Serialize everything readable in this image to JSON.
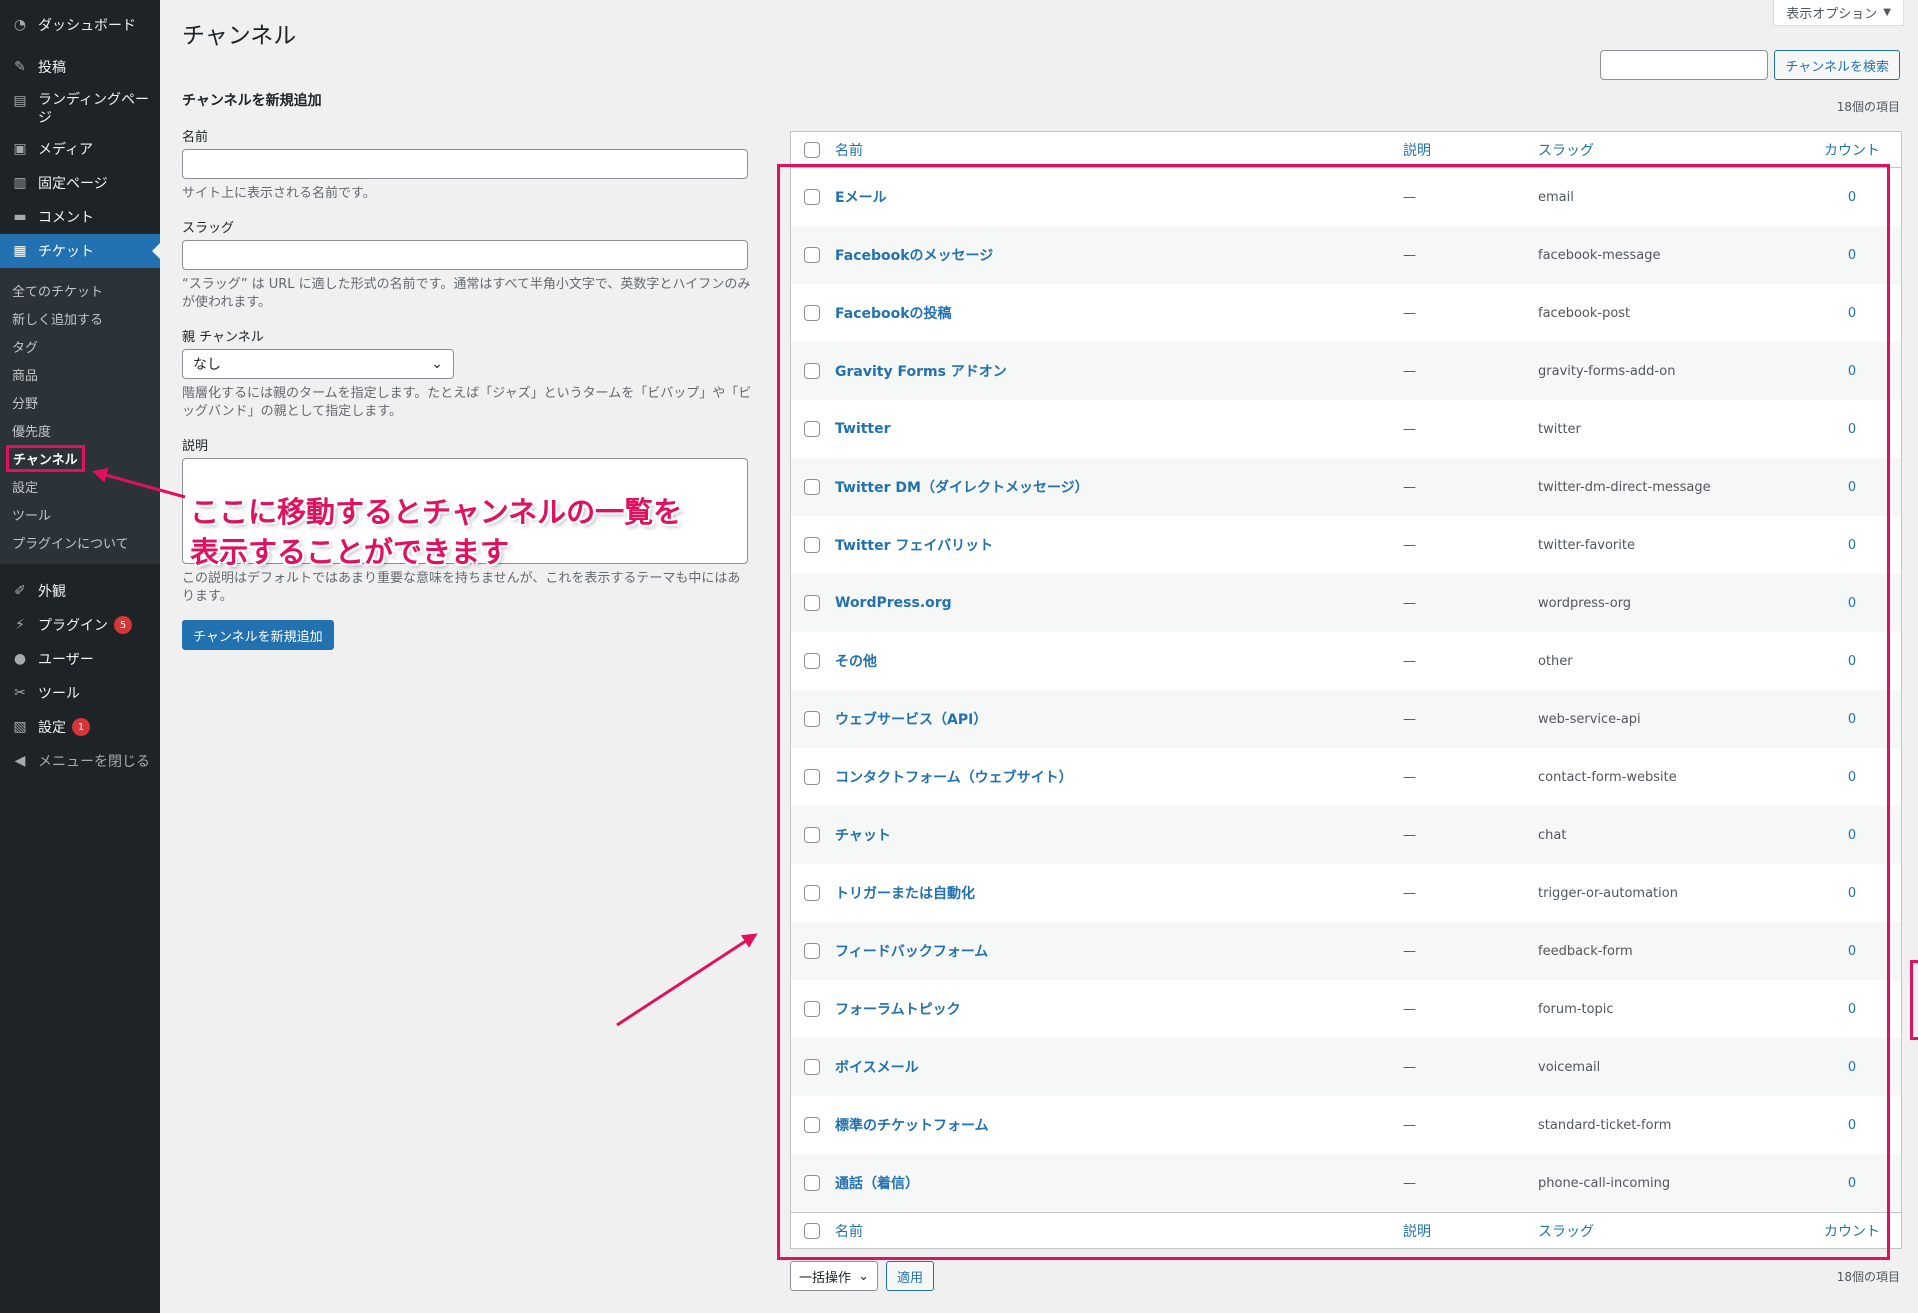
{
  "sidebar": {
    "dashboard": "ダッシュボード",
    "posts": "投稿",
    "landing": "ランディングページ",
    "media": "メディア",
    "pages": "固定ページ",
    "comments": "コメント",
    "tickets": "チケット",
    "sub": [
      "全てのチケット",
      "新しく追加する",
      "タグ",
      "商品",
      "分野",
      "優先度",
      "チャンネル",
      "設定",
      "ツール",
      "プラグインについて"
    ],
    "appearance": "外観",
    "plugins": "プラグイン",
    "plugins_badge": "5",
    "users": "ユーザー",
    "tools": "ツール",
    "settings": "設定",
    "settings_badge": "1",
    "collapse": "メニューを閉じる"
  },
  "header": {
    "screen_options": "表示オプション",
    "title": "チャンネル",
    "search_button": "チャンネルを検索",
    "items_count": "18個の項目"
  },
  "form": {
    "heading": "チャンネルを新規追加",
    "name_label": "名前",
    "name_desc": "サイト上に表示される名前です。",
    "slug_label": "スラッグ",
    "slug_desc": "“スラッグ” は URL に適した形式の名前です。通常はすべて半角小文字で、英数字とハイフンのみが使われます。",
    "parent_label": "親 チャンネル",
    "parent_value": "なし",
    "parent_desc": "階層化するには親のタームを指定します。たとえば「ジャズ」というタームを「ビバップ」や「ビッグバンド」の親として指定します。",
    "desc_label": "説明",
    "desc_desc": "この説明はデフォルトではあまり重要な意味を持ちませんが、これを表示するテーマも中にはあります。",
    "submit": "チャンネルを新規追加"
  },
  "table": {
    "columns": {
      "name": "名前",
      "desc": "説明",
      "slug": "スラッグ",
      "count": "カウント"
    },
    "rows": [
      {
        "name": "Eメール",
        "desc": "—",
        "slug": "email",
        "count": "0"
      },
      {
        "name": "Facebookのメッセージ",
        "desc": "—",
        "slug": "facebook-message",
        "count": "0"
      },
      {
        "name": "Facebookの投稿",
        "desc": "—",
        "slug": "facebook-post",
        "count": "0"
      },
      {
        "name": "Gravity Forms アドオン",
        "desc": "—",
        "slug": "gravity-forms-add-on",
        "count": "0"
      },
      {
        "name": "Twitter",
        "desc": "—",
        "slug": "twitter",
        "count": "0"
      },
      {
        "name": "Twitter DM（ダイレクトメッセージ）",
        "desc": "—",
        "slug": "twitter-dm-direct-message",
        "count": "0"
      },
      {
        "name": "Twitter フェイバリット",
        "desc": "—",
        "slug": "twitter-favorite",
        "count": "0"
      },
      {
        "name": "WordPress.org",
        "desc": "—",
        "slug": "wordpress-org",
        "count": "0"
      },
      {
        "name": "その他",
        "desc": "—",
        "slug": "other",
        "count": "0"
      },
      {
        "name": "ウェブサービス（API）",
        "desc": "—",
        "slug": "web-service-api",
        "count": "0"
      },
      {
        "name": "コンタクトフォーム（ウェブサイト）",
        "desc": "—",
        "slug": "contact-form-website",
        "count": "0"
      },
      {
        "name": "チャット",
        "desc": "—",
        "slug": "chat",
        "count": "0"
      },
      {
        "name": "トリガーまたは自動化",
        "desc": "—",
        "slug": "trigger-or-automation",
        "count": "0"
      },
      {
        "name": "フィードバックフォーム",
        "desc": "—",
        "slug": "feedback-form",
        "count": "0"
      },
      {
        "name": "フォーラムトピック",
        "desc": "—",
        "slug": "forum-topic",
        "count": "0"
      },
      {
        "name": "ボイスメール",
        "desc": "—",
        "slug": "voicemail",
        "count": "0"
      },
      {
        "name": "標準のチケットフォーム",
        "desc": "—",
        "slug": "standard-ticket-form",
        "count": "0"
      },
      {
        "name": "通話（着信）",
        "desc": "—",
        "slug": "phone-call-incoming",
        "count": "0"
      }
    ]
  },
  "bulk": {
    "select": "一括操作",
    "apply": "適用"
  },
  "annotation": {
    "line1": "ここに移動するとチャンネルの一覧を",
    "line2": "表示することができます",
    "color": "#e0115f"
  }
}
